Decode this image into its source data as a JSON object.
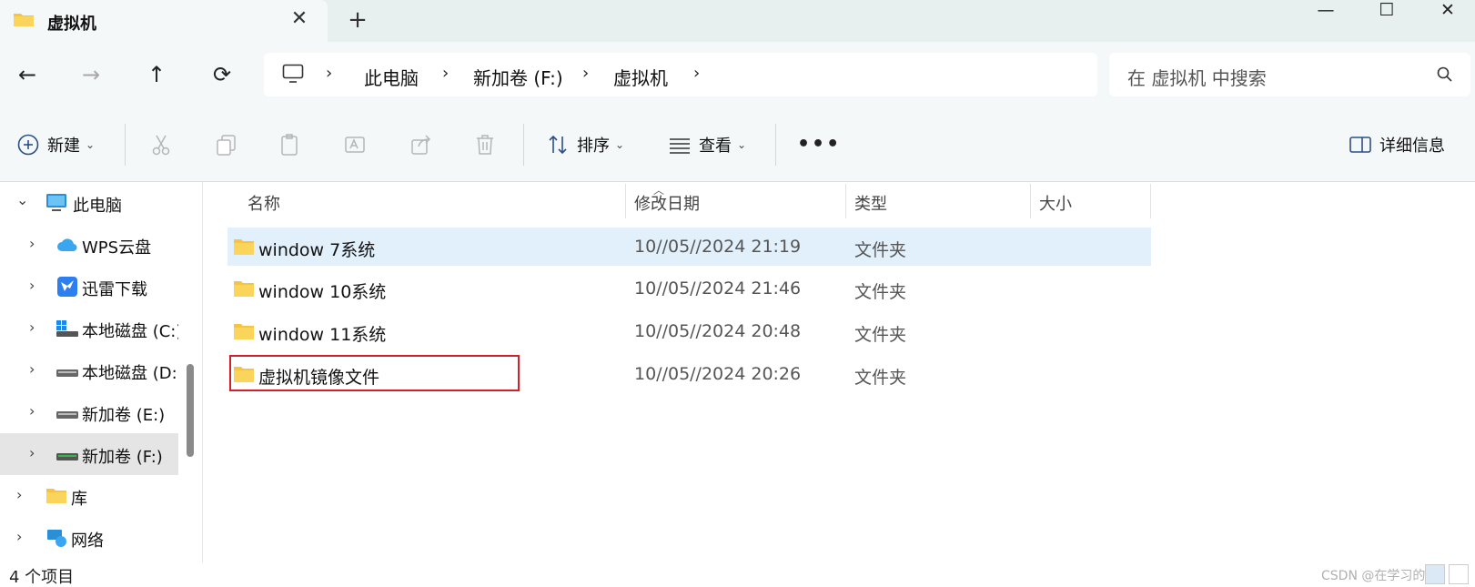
{
  "tab": {
    "title": "虚拟机",
    "close_glyph": "✕",
    "add_glyph": "+"
  },
  "window": {
    "minimize_glyph": "—",
    "maximize_glyph": "☐",
    "close_glyph": "✕"
  },
  "nav": {
    "back_glyph": "←",
    "forward_glyph": "→",
    "up_glyph": "↑",
    "refresh_glyph": "⟳"
  },
  "breadcrumb": {
    "items": [
      "此电脑",
      "新加卷 (F:)",
      "虚拟机"
    ],
    "separator": "›"
  },
  "search": {
    "placeholder": "在 虚拟机 中搜索"
  },
  "toolbar": {
    "new_label": "新建",
    "sort_label": "排序",
    "view_label": "查看",
    "more_glyph": "•••",
    "details_label": "详细信息",
    "chevron": "⌄"
  },
  "sidebar": {
    "items": [
      {
        "label": "此电脑",
        "icon": "computer-icon",
        "expanded": true,
        "selected": false
      },
      {
        "label": "WPS云盘",
        "icon": "cloud-icon",
        "expanded": false,
        "selected": false
      },
      {
        "label": "迅雷下载",
        "icon": "thunder-icon",
        "expanded": false,
        "selected": false
      },
      {
        "label": "本地磁盘 (C:)",
        "icon": "drive-c-icon",
        "expanded": false,
        "selected": false
      },
      {
        "label": "本地磁盘 (D:)",
        "icon": "drive-icon",
        "expanded": false,
        "selected": false
      },
      {
        "label": "新加卷 (E:)",
        "icon": "drive-icon",
        "expanded": false,
        "selected": false
      },
      {
        "label": "新加卷 (F:)",
        "icon": "drive-icon",
        "expanded": false,
        "selected": true
      },
      {
        "label": "库",
        "icon": "folder-icon",
        "expanded": false,
        "selected": false
      },
      {
        "label": "网络",
        "icon": "network-icon",
        "expanded": false,
        "selected": false
      }
    ]
  },
  "columns": {
    "name": "名称",
    "modified": "修改日期",
    "type": "类型",
    "size": "大小"
  },
  "files": [
    {
      "name": "window 7系统",
      "modified": "10//05//2024 21:19",
      "type": "文件夹",
      "selected": true
    },
    {
      "name": "window 10系统",
      "modified": "10//05//2024 21:46",
      "type": "文件夹",
      "selected": false
    },
    {
      "name": "window 11系统",
      "modified": "10//05//2024 20:48",
      "type": "文件夹",
      "selected": false
    },
    {
      "name": "虚拟机镜像文件",
      "modified": "10//05//2024 20:26",
      "type": "文件夹",
      "selected": false,
      "highlighted": true
    }
  ],
  "status": {
    "count": "4 个项目",
    "watermark": "CSDN @在学习的区"
  },
  "colors": {
    "highlight_border": "#d0202a",
    "selected_row": "#e2f0fb",
    "folder": "#f5c542"
  }
}
